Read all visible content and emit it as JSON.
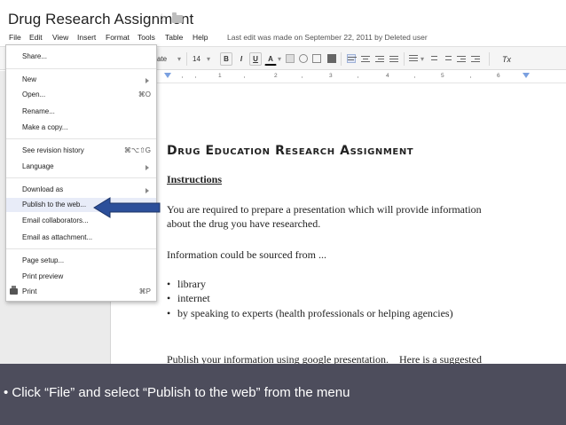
{
  "header": {
    "title": "Drug Research Assignment",
    "last_edit": "Last edit was made on September 22, 2011 by Deleted user"
  },
  "menubar": {
    "items": [
      "File",
      "Edit",
      "View",
      "Insert",
      "Format",
      "Tools",
      "Table",
      "Help"
    ]
  },
  "toolbar": {
    "style_suffix": "ate",
    "font_size": "14",
    "bold": "B",
    "italic": "I",
    "underline": "U",
    "text_color": "A",
    "clear_format": "Tx"
  },
  "ruler": {
    "numbers": [
      "1",
      "2",
      "3",
      "4",
      "5",
      "6"
    ]
  },
  "file_menu": {
    "items": [
      {
        "label": "Share...",
        "shortcut": "",
        "submenu": false
      },
      {
        "label": "New",
        "shortcut": "",
        "submenu": true
      },
      {
        "label": "Open...",
        "shortcut": "⌘O",
        "submenu": false
      },
      {
        "label": "Rename...",
        "shortcut": "",
        "submenu": false
      },
      {
        "label": "Make a copy...",
        "shortcut": "",
        "submenu": false
      },
      {
        "label": "See revision history",
        "shortcut": "⌘⌥⇧G",
        "submenu": false
      },
      {
        "label": "Language",
        "shortcut": "",
        "submenu": true
      },
      {
        "label": "Download as",
        "shortcut": "",
        "submenu": true
      },
      {
        "label": "Publish to the web...",
        "shortcut": "",
        "submenu": false
      },
      {
        "label": "Email collaborators...",
        "shortcut": "",
        "submenu": false
      },
      {
        "label": "Email as attachment...",
        "shortcut": "",
        "submenu": false
      },
      {
        "label": "Page setup...",
        "shortcut": "",
        "submenu": false
      },
      {
        "label": "Print preview",
        "shortcut": "",
        "submenu": false
      },
      {
        "label": "Print",
        "shortcut": "⌘P",
        "submenu": false
      }
    ]
  },
  "document": {
    "heading": "Drug Education Research Assignment",
    "subheading": "Instructions",
    "para1_line1": "You are required to prepare a presentation which will provide information",
    "para1_line2": "about the drug you have researched.",
    "para2": "Information could be sourced from ...",
    "bullets": [
      "library",
      "internet",
      "by speaking to experts (health professionals or helping agencies)"
    ],
    "para3": "Publish your information using google presentation.    Here is a suggested"
  },
  "caption": {
    "text": "Click “File” and select “Publish to the web” from the menu"
  },
  "colors": {
    "caption_bg": "#4d4d5c",
    "arrow": "#2c4f9a",
    "highlight": "#e8ecf8"
  }
}
